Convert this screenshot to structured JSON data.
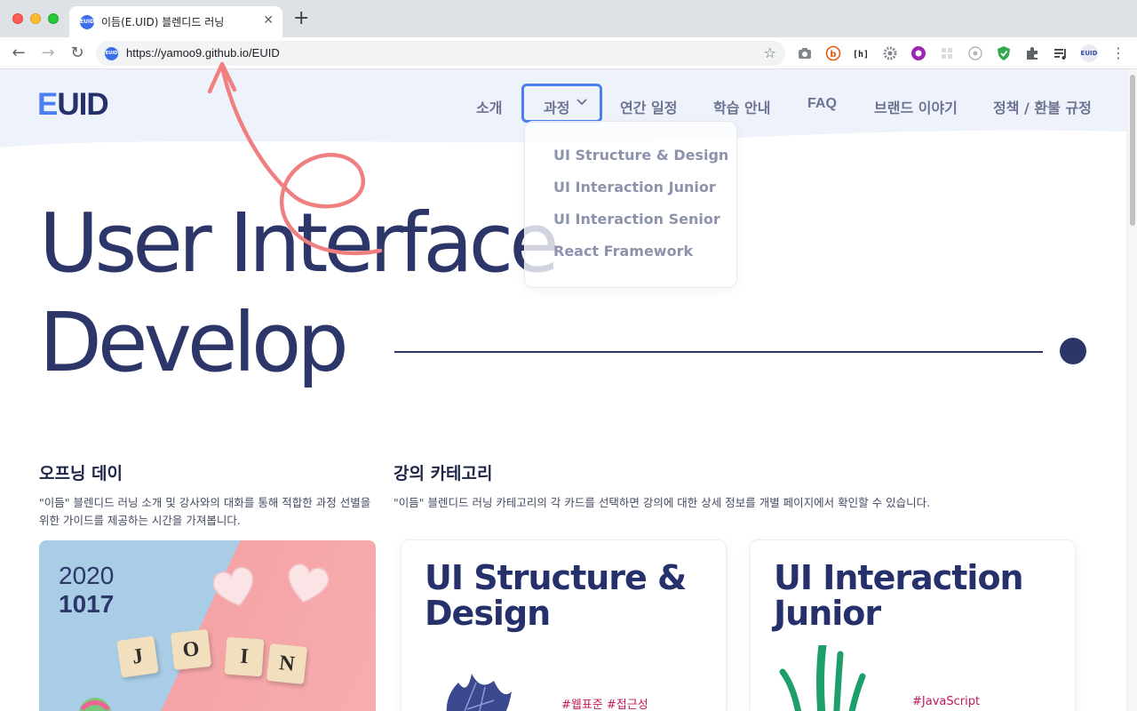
{
  "browser": {
    "tab_title": "이듬(E.UID) 블렌디드 러닝",
    "tab_favicon_text": "EUID",
    "url": "https://yamoo9.github.io/EUID",
    "close_glyph": "✕",
    "newtab_glyph": "+",
    "back_glyph": "←",
    "forward_glyph": "→",
    "reload_glyph": "↻",
    "star_glyph": "☆",
    "extensions": [
      "camera-icon",
      "b-icon",
      "hi-icon",
      "gear-icon",
      "music-icon",
      "grid-icon",
      "eye-icon",
      "shield-icon",
      "puzzle-icon",
      "playlist-icon",
      "profile-avatar"
    ],
    "profile_text": "EUID"
  },
  "site": {
    "logo_e": "E",
    "logo_rest": "UID",
    "nav": {
      "intro": "소개",
      "courses": "과정",
      "schedule": "연간 일정",
      "guide": "학습 안내",
      "faq": "FAQ",
      "brand": "브랜드 이야기",
      "policy": "정책 / 환불 규정"
    },
    "dropdown": [
      "UI Structure & Design",
      "UI Interaction Junior",
      "UI Interaction Senior",
      "React Framework"
    ]
  },
  "hero": {
    "line1": "User Interface",
    "line2": "Develop"
  },
  "opening": {
    "title": "오프닝 데이",
    "desc": "\"이듬\" 블렌디드 러닝 소개 및 강사와의 대화를 통해 적합한 과정 선별을 위한 가이드를 제공하는 시간을 가져봅니다.",
    "year": "2020",
    "date": "1017",
    "tiles": [
      "J",
      "O",
      "I",
      "N"
    ]
  },
  "category": {
    "title": "강의 카테고리",
    "desc": "\"이듬\" 블렌디드 러닝 카테고리의 각 카드를 선택하면 강의에 대한 상세 정보를 개별 페이지에서 확인할 수 있습니다.",
    "cards": [
      {
        "title_line1": "UI Structure &",
        "title_line2": "Design",
        "tags": "#웹표준  #접근성"
      },
      {
        "title_line1": "UI Interaction",
        "title_line2": "Junior",
        "tags": "#JavaScript"
      }
    ]
  },
  "colors": {
    "brand_navy": "#2d3668",
    "accent_blue": "#4d7ff0",
    "tag_pink": "#c2185b",
    "annotation": "#f08080"
  }
}
